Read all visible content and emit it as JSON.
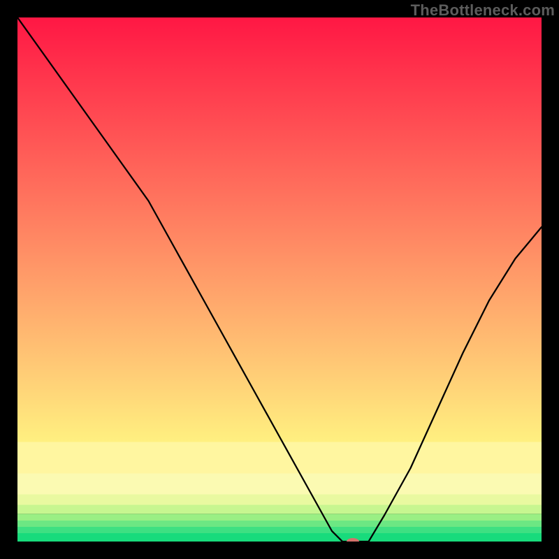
{
  "watermark": "TheBottleneck.com",
  "chart_data": {
    "type": "line",
    "title": "",
    "xlabel": "",
    "ylabel": "",
    "xlim": [
      0,
      100
    ],
    "ylim": [
      0,
      100
    ],
    "x": [
      0,
      5,
      10,
      15,
      20,
      25,
      30,
      35,
      40,
      45,
      50,
      55,
      60,
      62,
      65,
      67,
      70,
      75,
      80,
      85,
      90,
      95,
      100
    ],
    "values": [
      100,
      93,
      86,
      79,
      72,
      65,
      56,
      47,
      38,
      29,
      20,
      11,
      2,
      0,
      0,
      0,
      5,
      14,
      25,
      36,
      46,
      54,
      60
    ],
    "marker": {
      "x": 64,
      "y": 0,
      "color": "#d5716b",
      "rx": 9,
      "ry": 5
    },
    "background_bands": [
      {
        "y0": 0.0,
        "y1": 1.6,
        "color": "#18db7c"
      },
      {
        "y0": 1.6,
        "y1": 2.8,
        "color": "#3ee082"
      },
      {
        "y0": 2.8,
        "y1": 4.0,
        "color": "#6ce783"
      },
      {
        "y0": 4.0,
        "y1": 5.3,
        "color": "#9aef84"
      },
      {
        "y0": 5.3,
        "y1": 7.0,
        "color": "#c7f690"
      },
      {
        "y0": 7.0,
        "y1": 9.0,
        "color": "#e9f9a0"
      },
      {
        "y0": 9.0,
        "y1": 13.0,
        "color": "#fbfab2"
      },
      {
        "y0": 13.0,
        "y1": 19.0,
        "color": "#fff6a0"
      },
      {
        "y0": 19.0,
        "y1": 100.0,
        "gradient": [
          "#fff080",
          "#ff1744"
        ]
      }
    ]
  }
}
